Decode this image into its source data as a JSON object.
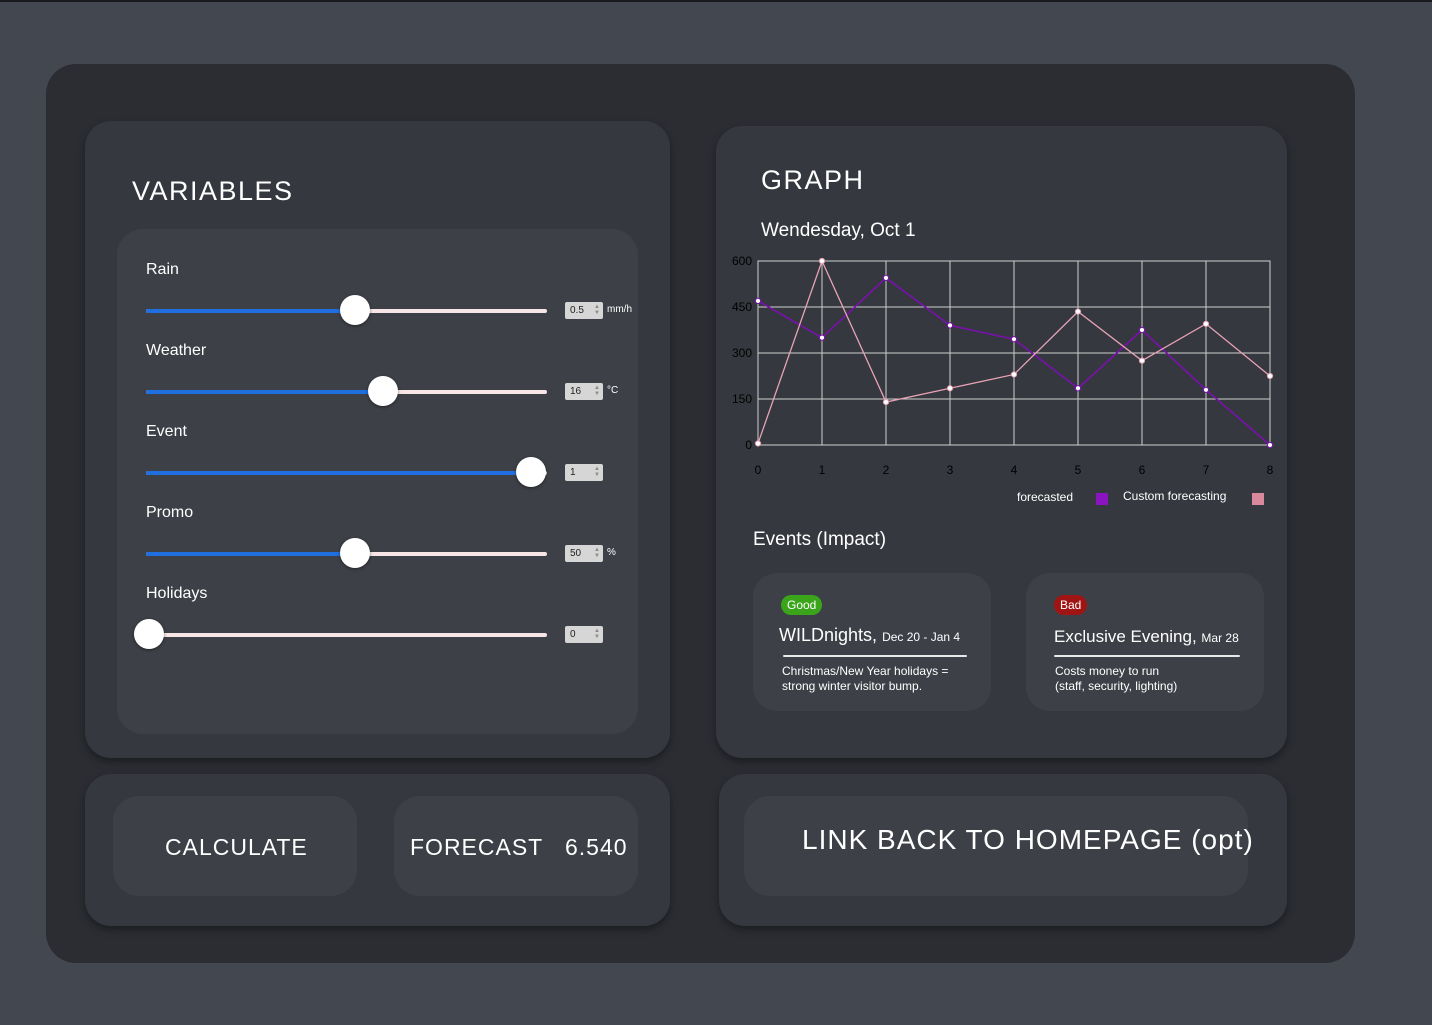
{
  "variables": {
    "title": "VARIABLES",
    "items": [
      {
        "label": "Rain",
        "value": "0.5",
        "unit": "mm/h",
        "level": 0.52
      },
      {
        "label": "Weather",
        "value": "16",
        "unit": "°C",
        "level": 0.59
      },
      {
        "label": "Event",
        "value": "1",
        "unit": "",
        "level": 0.96
      },
      {
        "label": "Promo",
        "value": "50",
        "unit": "%",
        "level": 0.52
      },
      {
        "label": "Holidays",
        "value": "0",
        "unit": "",
        "level": 0.0
      }
    ]
  },
  "graph": {
    "title": "GRAPH",
    "date": "Wendesday, Oct 1"
  },
  "chart_data": {
    "type": "line",
    "x": [
      0,
      1,
      2,
      3,
      4,
      5,
      6,
      7,
      8
    ],
    "xlim": [
      0,
      8
    ],
    "ylim": [
      0,
      600
    ],
    "yticks": [
      0,
      150,
      300,
      450,
      600
    ],
    "grid": true,
    "legend_position": "bottom-right",
    "series": [
      {
        "name": "forecasted",
        "color": "#7b10b0",
        "values": [
          470,
          350,
          545,
          390,
          345,
          185,
          375,
          180,
          0
        ]
      },
      {
        "name": "Custom forecasting",
        "color": "#e8a3b6",
        "values": [
          5,
          600,
          140,
          185,
          230,
          435,
          275,
          395,
          225
        ]
      }
    ]
  },
  "legend": {
    "items": [
      {
        "label": "forecasted",
        "color": "#8a14bf"
      },
      {
        "label": "Custom forecasting",
        "color": "#d9899c"
      }
    ]
  },
  "events": {
    "title": "Events (Impact)",
    "cards": [
      {
        "badge": "Good",
        "badge_color": "#3aa51b",
        "name": "WILDnights,",
        "date": "Dec 20 - Jan 4",
        "desc1": "Christmas/New Year holidays =",
        "desc2": "strong winter visitor bump."
      },
      {
        "badge": "Bad",
        "badge_color": "#a11414",
        "name": "Exclusive Evening,",
        "date": "Mar 28",
        "desc1": "Costs money to run",
        "desc2": "(staff, security, lighting)"
      }
    ]
  },
  "actions": {
    "calculate_label": "CALCULATE",
    "forecast_label": "FORECAST",
    "forecast_value": "6.540",
    "homepage_link": "LINK BACK TO HOMEPAGE (opt)"
  }
}
